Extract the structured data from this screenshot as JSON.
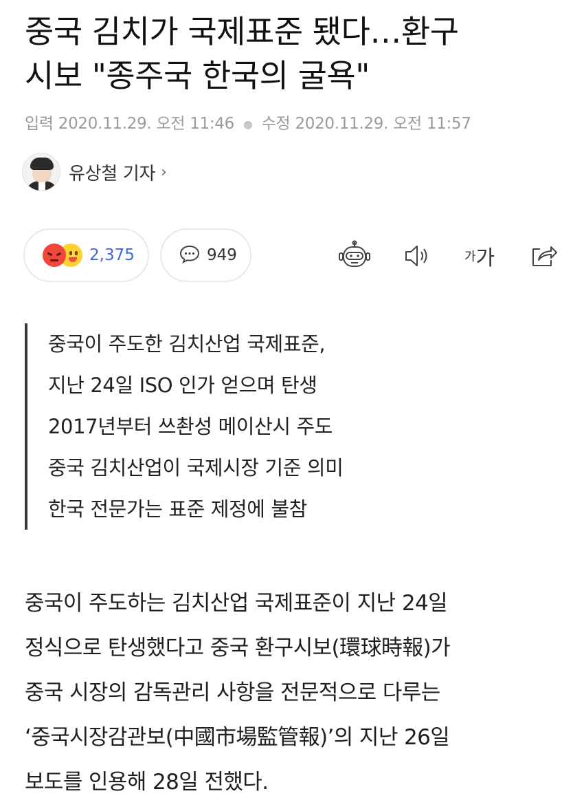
{
  "article": {
    "title_line1": "중국 김치가 국제표준 됐다…환구",
    "title_line2": "시보 \"종주국 한국의 굴욕\"",
    "posted_label": "입력",
    "posted": "2020.11.29. 오전 11:46",
    "modified_label": "수정",
    "modified": "2020.11.29. 오전 11:57"
  },
  "author": {
    "name": "유상철 기자",
    "chevron": "›"
  },
  "reactions": {
    "count": "2,375",
    "icons": [
      "angry-emoji",
      "wink-emoji"
    ]
  },
  "comments": {
    "count": "949",
    "icon": "speech-bubble-icon"
  },
  "toolbar": {
    "font_small": "가",
    "font_large": "가",
    "icons": [
      "robot-summary-icon",
      "speaker-icon",
      "font-size-icon",
      "share-icon"
    ]
  },
  "summary": [
    "중국이 주도한 김치산업 국제표준,",
    "지난 24일 ISO 인가 얻으며 탄생",
    "2017년부터 쓰촨성 메이산시 주도",
    "중국 김치산업이 국제시장 기준 의미",
    "한국 전문가는 표준 제정에 불참"
  ],
  "body": [
    "중국이 주도하는 김치산업 국제표준이 지난 24일",
    "정식으로 탄생했다고 중국 환구시보(環球時報)가",
    "중국 시장의 감독관리 사항을 전문적으로 다루는",
    "‘중국시장감관보(中國市場監管報)’의 지난 26일",
    "보도를 인용해 28일 전했다."
  ]
}
